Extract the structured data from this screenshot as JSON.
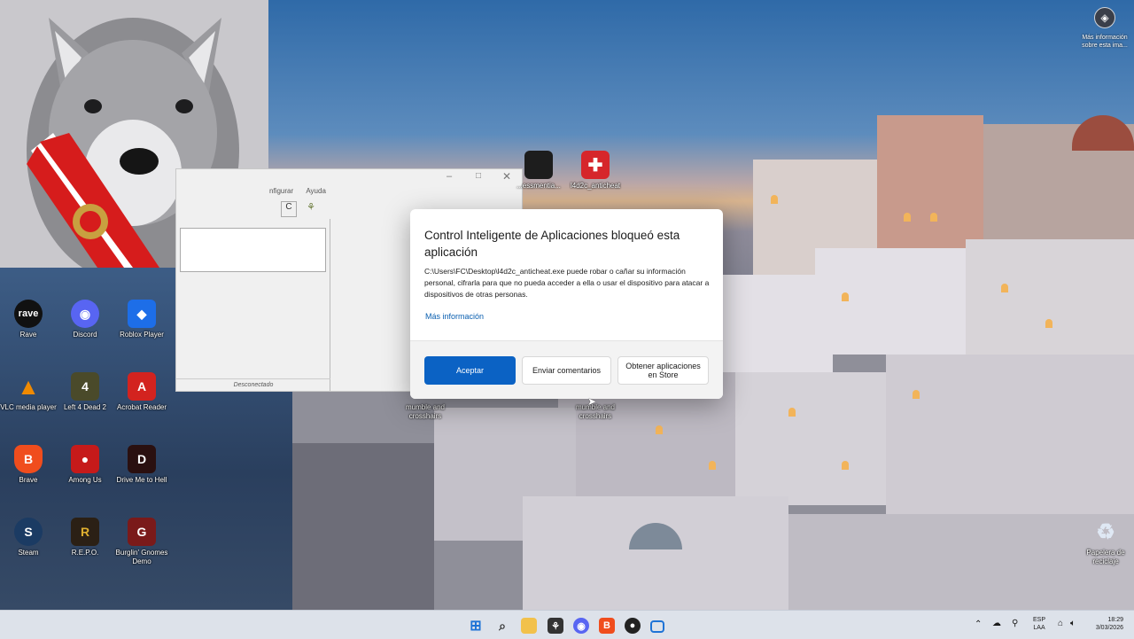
{
  "dialog": {
    "title": "Control Inteligente de Aplicaciones bloqueó esta aplicación",
    "message": "C:\\Users\\FC\\Desktop\\l4d2c_anticheat.exe puede robar o cañar su información personal, cifrarla para que no pueda acceder a ella o usar el dispositivo para atacar a dispositivos de otras personas.",
    "more_info": "Más información",
    "accept": "Aceptar",
    "feedback": "Enviar comentarios",
    "store": "Obtener aplicaciones en Store"
  },
  "background_window": {
    "menu": [
      "nfigurar",
      "Ayuda"
    ],
    "status": "Desconectado"
  },
  "corner_widget": {
    "label": "Más información sobre esta ima..."
  },
  "desktop_icons": [
    {
      "label": "Rave",
      "icon": "rave-icon",
      "color": "#111111",
      "glyph": "rave"
    },
    {
      "label": "Discord",
      "icon": "discord-icon",
      "color": "#5865f2",
      "glyph": "◉"
    },
    {
      "label": "Roblox Player",
      "icon": "roblox-icon",
      "color": "#1d6ee8",
      "glyph": "◆"
    },
    {
      "label": "VLC media player",
      "icon": "vlc-icon",
      "color": "#f08a00",
      "glyph": "▲"
    },
    {
      "label": "Left 4 Dead 2",
      "icon": "l4d2-icon",
      "color": "#4a4a2a",
      "glyph": "4"
    },
    {
      "label": "Acrobat Reader",
      "icon": "acrobat-icon",
      "color": "#d3231f",
      "glyph": "A"
    },
    {
      "label": "Brave",
      "icon": "brave-icon",
      "color": "#f04d1d",
      "glyph": "B"
    },
    {
      "label": "Among Us",
      "icon": "among-us-icon",
      "color": "#c61a1a",
      "glyph": "●"
    },
    {
      "label": "Drive Me to Hell",
      "icon": "drive-me-to-hell-icon",
      "color": "#2a1010",
      "glyph": "D"
    },
    {
      "label": "Steam",
      "icon": "steam-icon",
      "color": "#1b3b63",
      "glyph": "S"
    },
    {
      "label": "R.E.P.O.",
      "icon": "repo-icon",
      "color": "#2b2015",
      "glyph": "R"
    },
    {
      "label": "Burglin' Gnomes Demo",
      "icon": "burglin-gnomes-icon",
      "color": "#7a1a1a",
      "glyph": "G"
    },
    {
      "label": "...essmentia...",
      "icon": "app-dark-icon",
      "color": "#1d1d1d",
      "glyph": "▪"
    },
    {
      "label": "l4d2c_anticheat",
      "icon": "anticheat-icon",
      "color": "#d6262b",
      "glyph": "✚"
    },
    {
      "label": "mumble and crosshairs",
      "icon": "mumble-icon",
      "color": "#2a2a2a",
      "glyph": ""
    },
    {
      "label": "mumble and crosshairs",
      "icon": "mumble-icon-2",
      "color": "#2a2a2a",
      "glyph": ""
    },
    {
      "label": "Papelera de reciclaje",
      "icon": "recycle-bin-icon",
      "color": "#cfd8e6",
      "glyph": "♻"
    }
  ],
  "taskbar": {
    "tray": {
      "lang1": "ESP",
      "lang2": "LAA",
      "time": "18:29",
      "date": "3/03/2026"
    }
  }
}
